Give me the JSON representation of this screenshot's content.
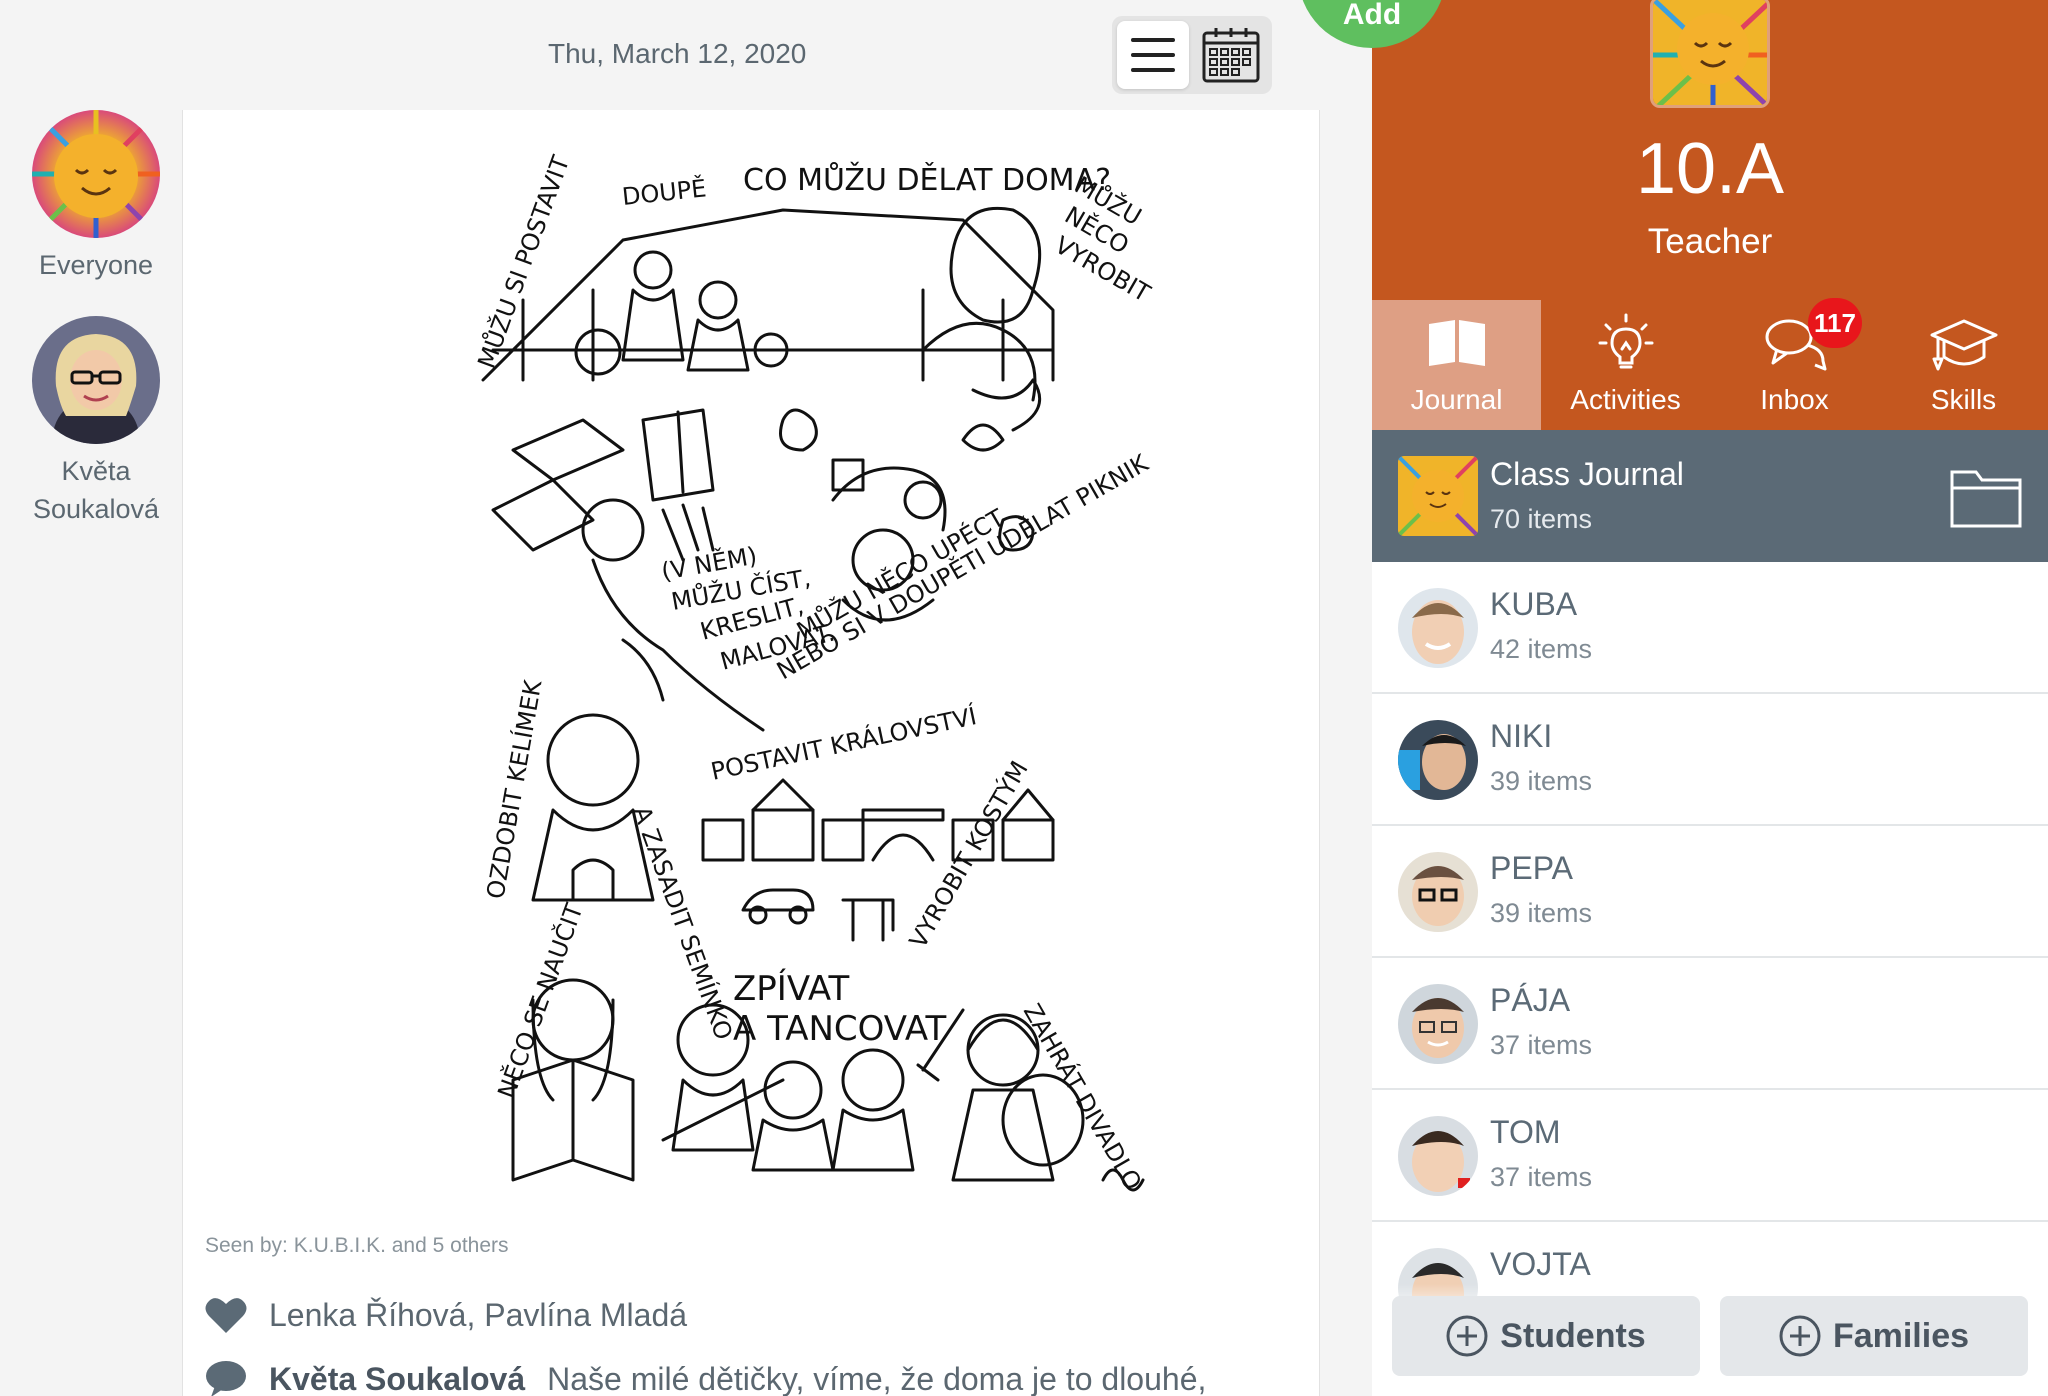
{
  "feed": {
    "date": "Thu, March 12, 2020",
    "view_modes": [
      "list-view",
      "calendar-view"
    ],
    "add_label": "Add"
  },
  "authors": [
    {
      "name": "Everyone",
      "avatar": "sun-avatar"
    },
    {
      "name_line1": "Květa",
      "name_line2": "Soukalová",
      "avatar": "person-avatar"
    }
  ],
  "post": {
    "image_title": "CO MŮŽU DĚLAT DOMA?",
    "seen_by": "Seen by: K.U.B.I.K. and 5 others",
    "likes": "Lenka Říhová, Pavlína Mladá",
    "comment_author": "Květa Soukalová",
    "comment_text": "Naše milé dětičky, víme, že doma je to dlouhé,"
  },
  "class_panel": {
    "class_name": "10.A",
    "role": "Teacher",
    "tabs": [
      {
        "label": "Journal",
        "icon": "book-icon",
        "active": true
      },
      {
        "label": "Activities",
        "icon": "lightbulb-icon",
        "active": false
      },
      {
        "label": "Inbox",
        "icon": "chat-icon",
        "active": false,
        "badge": "117"
      },
      {
        "label": "Skills",
        "icon": "graduation-cap-icon",
        "active": false
      }
    ],
    "journal": {
      "title": "Class Journal",
      "count": "70 items"
    },
    "students": [
      {
        "name": "KUBA",
        "count": "42 items"
      },
      {
        "name": "NIKI",
        "count": "39 items"
      },
      {
        "name": "PEPA",
        "count": "39 items"
      },
      {
        "name": "PÁJA",
        "count": "37 items"
      },
      {
        "name": "TOM",
        "count": "37 items"
      },
      {
        "name": "VOJTA",
        "count": ""
      }
    ],
    "actions": {
      "students": "Students",
      "families": "Families"
    }
  },
  "colors": {
    "header_orange": "#c4571f",
    "tab_active": "#de9f84",
    "journal_row": "#5b6a76",
    "badge_red": "#e8161b",
    "add_green": "#5fbf5f"
  }
}
